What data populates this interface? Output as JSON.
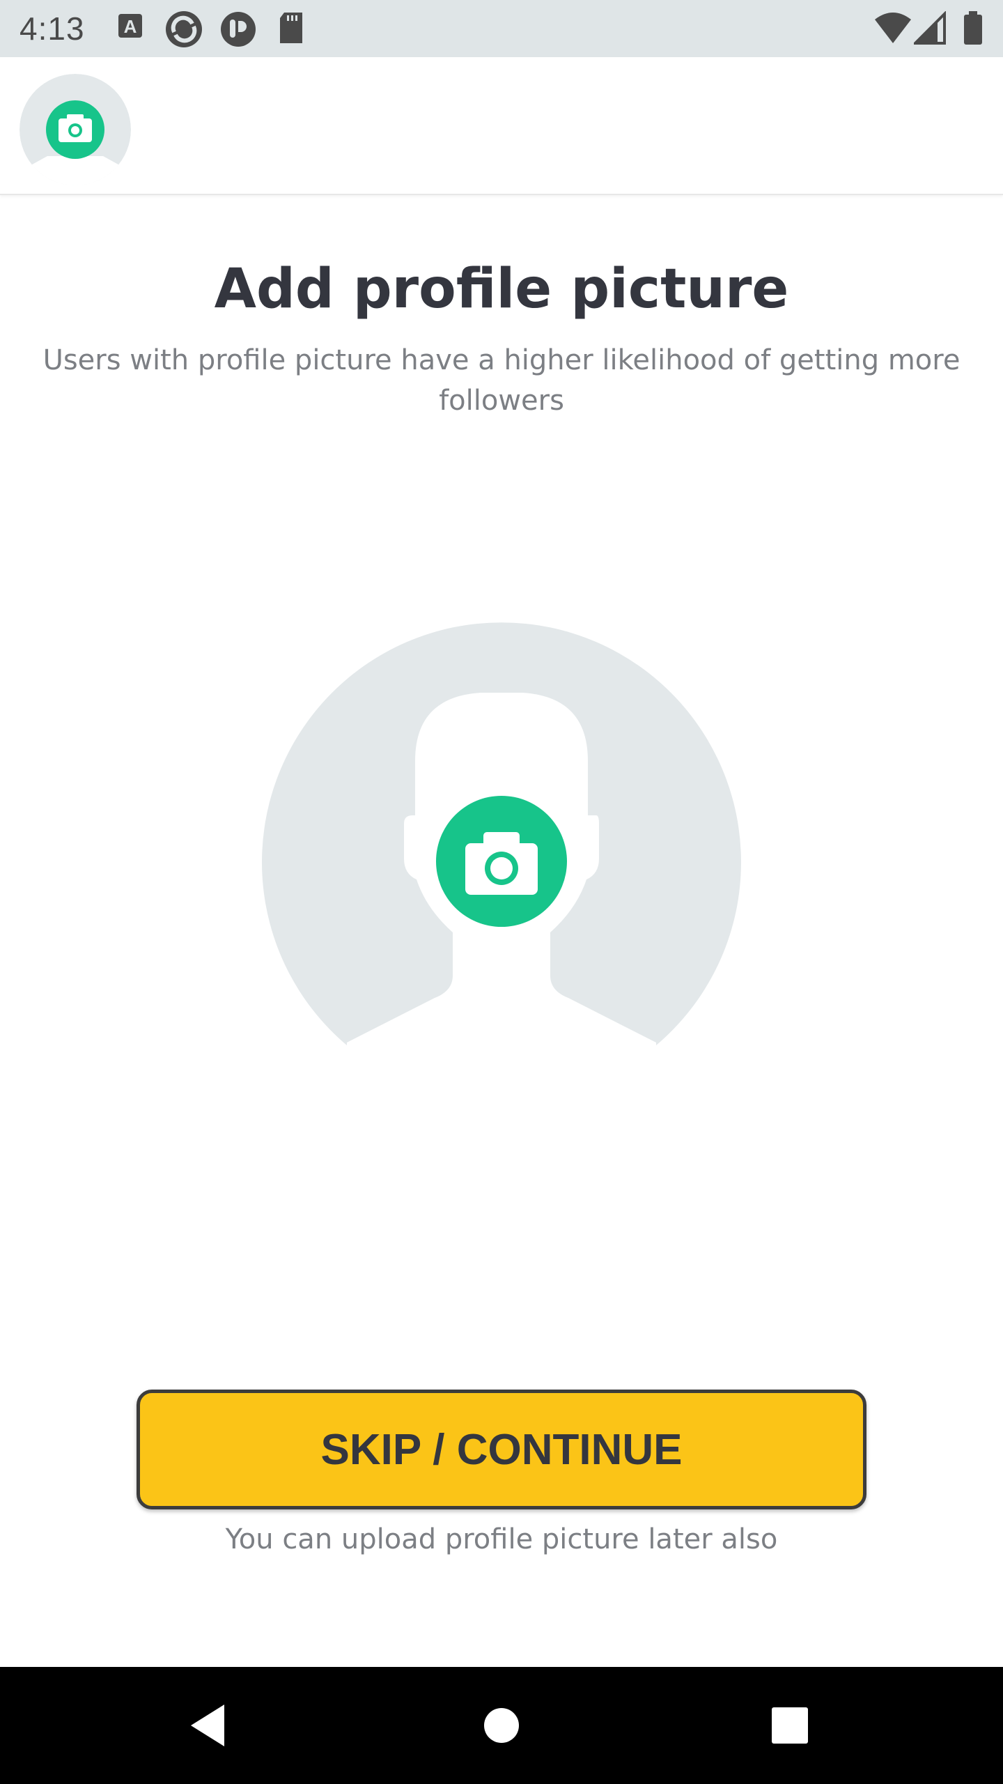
{
  "status_bar": {
    "time": "4:13",
    "notification_icons": [
      "a-box-icon",
      "sync-icon",
      "pocket-icon",
      "sd-card-icon"
    ],
    "system_icons": [
      "wifi-icon",
      "signal-icon",
      "battery-icon"
    ]
  },
  "header": {
    "avatar_icon": "camera-icon"
  },
  "main": {
    "title": "Add profile picture",
    "subtitle": "Users with profile picture have a higher likelihood of getting more followers",
    "profile_picker_icon": "camera-icon",
    "continue_label": "SKIP / CONTINUE",
    "later_hint": "You can upload profile picture later also"
  },
  "nav_bar": {
    "buttons": [
      "back-icon",
      "home-icon",
      "recents-icon"
    ]
  },
  "colors": {
    "accent_green": "#17c48a",
    "button_yellow": "#fbc417",
    "placeholder_gray": "#e3e8ea",
    "title_text": "#34363f",
    "secondary_text": "#7c7f84"
  }
}
